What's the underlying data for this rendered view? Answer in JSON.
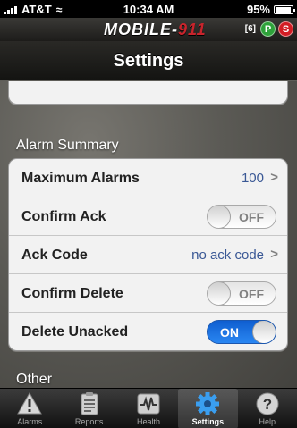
{
  "status_bar": {
    "carrier": "AT&T",
    "time": "10:34 AM",
    "battery": "95%",
    "battery_level": 0.95
  },
  "brand": {
    "name_prefix": "MOBILE-",
    "name_suffix": "911",
    "count": "[6]",
    "badge_p": "P",
    "badge_s": "S"
  },
  "nav": {
    "title": "Settings"
  },
  "sections": {
    "alarm_summary": "Alarm Summary",
    "other": "Other"
  },
  "alarm_rows": {
    "max_alarms": {
      "label": "Maximum Alarms",
      "value": "100"
    },
    "confirm_ack": {
      "label": "Confirm Ack",
      "toggle": "OFF"
    },
    "ack_code": {
      "label": "Ack Code",
      "value": "no ack code"
    },
    "confirm_delete": {
      "label": "Confirm Delete",
      "toggle": "OFF"
    },
    "delete_unacked": {
      "label": "Delete Unacked",
      "toggle": "ON"
    }
  },
  "tabs": [
    {
      "label": "Alarms",
      "icon": "warning-icon"
    },
    {
      "label": "Reports",
      "icon": "clipboard-icon"
    },
    {
      "label": "Health",
      "icon": "pulse-icon"
    },
    {
      "label": "Settings",
      "icon": "gear-icon"
    },
    {
      "label": "Help",
      "icon": "help-icon"
    }
  ],
  "colors": {
    "accent_blue": "#2a87f2",
    "brand_red": "#c8242c",
    "badge_green": "#2ea23a",
    "value_blue": "#3a5895"
  }
}
